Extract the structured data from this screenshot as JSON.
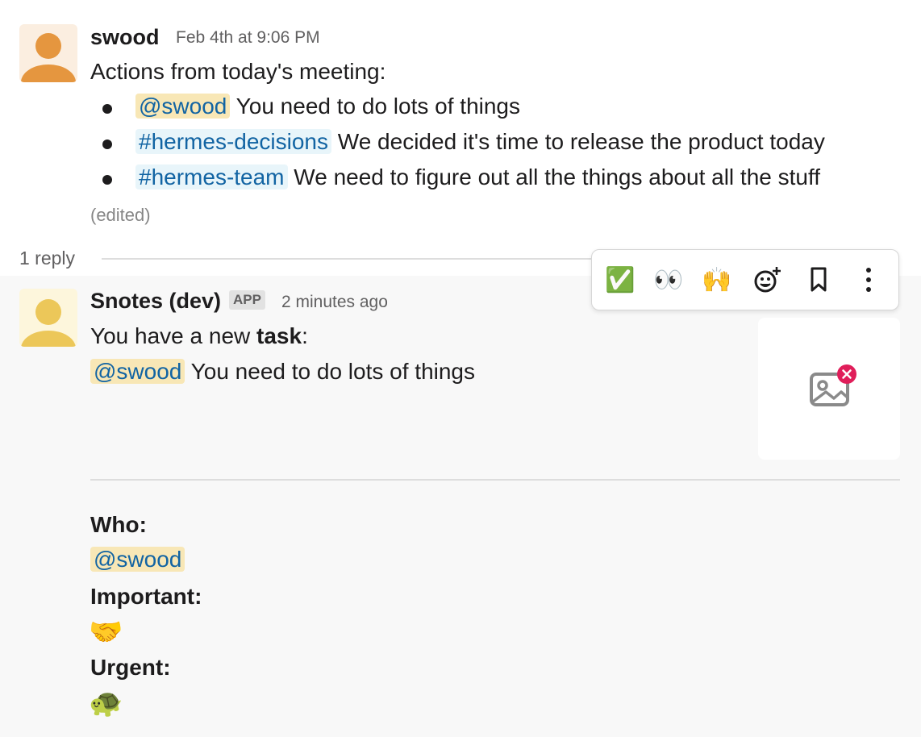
{
  "message1": {
    "author": "swood",
    "timestamp": "Feb 4th at 9:06 PM",
    "intro": "Actions from today's meeting:",
    "items": [
      {
        "tag": "@swood",
        "tag_type": "mention",
        "text": "You need to do lots of things"
      },
      {
        "tag": "#hermes-decisions",
        "tag_type": "channel",
        "text": "We decided it's time to release the product today"
      },
      {
        "tag": "#hermes-team",
        "tag_type": "channel",
        "text": "We need to figure out all the things about all the stuff"
      }
    ],
    "edited": "(edited)",
    "replies": "1 reply",
    "avatar_color": "#e5963f"
  },
  "toolbar": {
    "reactions": [
      "✅",
      "👀",
      "🙌"
    ],
    "icons": [
      "add-reaction-icon",
      "bookmark-icon",
      "more-actions-icon"
    ]
  },
  "message2": {
    "author": "Snotes (dev)",
    "badge": "APP",
    "timestamp": "2 minutes ago",
    "line1_prefix": "You have a new ",
    "line1_bold": "task",
    "line1_suffix": ":",
    "mention": "@swood",
    "task_text": "You need to do lots of things",
    "who_label": "Who:",
    "who_value": "@swood",
    "important_label": "Important:",
    "important_value": "🤝",
    "urgent_label": "Urgent:",
    "urgent_value": "🐢",
    "avatar_color": "#ecc759"
  }
}
